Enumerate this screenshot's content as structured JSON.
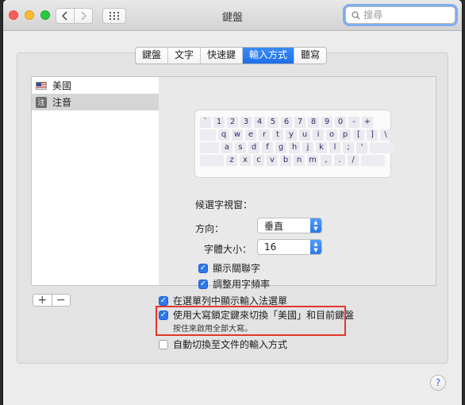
{
  "window": {
    "title": "鍵盤"
  },
  "search": {
    "placeholder": "搜尋"
  },
  "tabs": [
    {
      "label": "鍵盤",
      "active": false
    },
    {
      "label": "文字",
      "active": false
    },
    {
      "label": "快速鍵",
      "active": false
    },
    {
      "label": "輸入方式",
      "active": true
    },
    {
      "label": "聽寫",
      "active": false
    }
  ],
  "input_sources": [
    {
      "label": "美國",
      "icon": "us-flag-icon",
      "selected": false
    },
    {
      "label": "注音",
      "icon": "zhuyin-icon",
      "icon_glyph": "注",
      "selected": true
    }
  ],
  "keyboard_rows": [
    [
      "`",
      "1",
      "2",
      "3",
      "4",
      "5",
      "6",
      "7",
      "8",
      "9",
      "0",
      "-",
      "+"
    ],
    [
      "q",
      "w",
      "e",
      "r",
      "t",
      "y",
      "u",
      "i",
      "o",
      "p",
      "[",
      "]",
      "\\"
    ],
    [
      "a",
      "s",
      "d",
      "f",
      "g",
      "h",
      "j",
      "k",
      "l",
      ";",
      "'"
    ],
    [
      "z",
      "x",
      "c",
      "v",
      "b",
      "n",
      "m",
      ",",
      ".",
      "/"
    ]
  ],
  "candidate_window": {
    "title": "候選字視窗：",
    "direction_label": "方向：",
    "direction_value": "垂直",
    "font_size_label": "字體大小：",
    "font_size_value": "16",
    "show_related_label": "顯示關聯字",
    "show_related_checked": true,
    "adjust_frequency_label": "調整用字頻率",
    "adjust_frequency_checked": true
  },
  "options": {
    "show_in_menubar_label": "在選單列中顯示輸入法選單",
    "show_in_menubar_checked": true,
    "capslock_switch_label": "使用大寫鎖定鍵來切換「美國」和目前鍵盤",
    "capslock_switch_checked": true,
    "capslock_hint": "按住來啟用全部大寫。",
    "auto_switch_label": "自動切換至文件的輸入方式",
    "auto_switch_checked": false
  },
  "list_controls": {
    "add": "+",
    "remove": "−"
  },
  "help": "?",
  "colors": {
    "accent": "#2c78ec",
    "highlight": "#e2362c"
  }
}
